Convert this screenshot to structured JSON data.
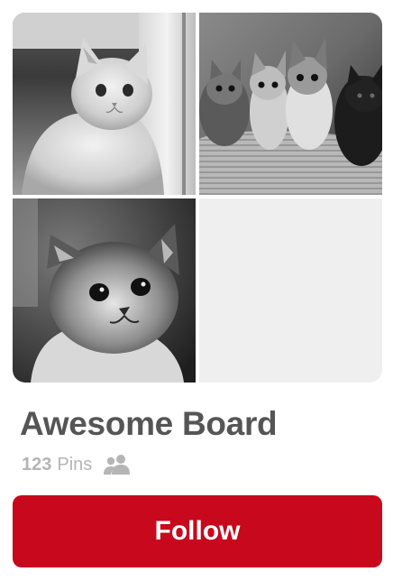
{
  "board": {
    "title": "Awesome Board",
    "pin_count": "123",
    "pins_label": "Pins",
    "collaborators_icon": "group-icon",
    "cover_images": [
      {
        "subject": "kitten-by-door",
        "filled": true
      },
      {
        "subject": "kittens-in-basket",
        "filled": true
      },
      {
        "subject": "kitten-closeup",
        "filled": true
      },
      {
        "subject": "empty",
        "filled": false
      }
    ]
  },
  "actions": {
    "follow_label": "Follow"
  },
  "colors": {
    "follow_button": "#c8081c",
    "title_text": "#555555",
    "meta_text": "#b5b5b5",
    "empty_tile": "#efefef"
  }
}
